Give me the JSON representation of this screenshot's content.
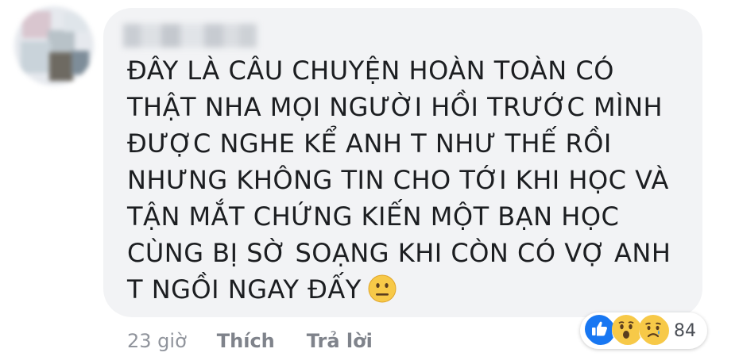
{
  "comment": {
    "author_name": "",
    "text_lines": [
      "ĐÂY LÀ CÂU CHUYỆN HOÀN TOÀN CÓ",
      "THẬT NHA MỌI NGƯỜI HỒI TRƯỚC MÌNH",
      "ĐƯỢC NGHE KỂ ANH T NHƯ THẾ RỒI",
      "NHƯNG KHÔNG TIN CHO TỚI KHI HỌC VÀ",
      "TẬN MẮT CHỨNG KIẾN MỘT BẠN HỌC",
      "CÙNG BỊ SỜ SOẠNG KHI CÒN CÓ VỢ ANH",
      "T NGỒI NGAY ĐẤY"
    ],
    "trailing_emoji": "neutral-face-emoji",
    "timestamp": "23 giờ",
    "like_label": "Thích",
    "reply_label": "Trả lời",
    "reactions": {
      "icons": [
        "like-reaction-icon",
        "wow-reaction-icon",
        "sad-reaction-icon"
      ],
      "count": "84"
    }
  },
  "colors": {
    "bubble": "#f2f3f5",
    "text": "#1c1e21",
    "meta": "#90949c",
    "like_blue": "#1877f2",
    "reaction_yellow": "#f7c948"
  }
}
